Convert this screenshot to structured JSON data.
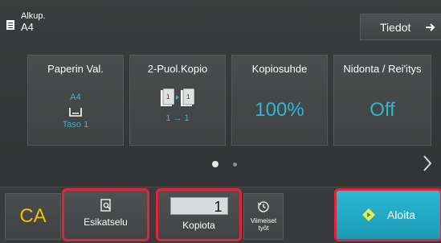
{
  "header": {
    "original_label": "Alkup.",
    "original_size": "A4",
    "info_label": "Tiedot"
  },
  "cards": [
    {
      "title": "Paperin Val.",
      "value": "A4",
      "sub": "Taso 1"
    },
    {
      "title": "2-Puol.Kopio",
      "sub": "1 → 1"
    },
    {
      "title": "Kopiosuhde",
      "value": "100%"
    },
    {
      "title": "Nidonta / Rei'itys",
      "value": "Off"
    }
  ],
  "bottom": {
    "ca_label": "CA",
    "preview_label": "Esikatselu",
    "copies_value": "1",
    "copies_label": "Kopiota",
    "recent_label_1": "Viimeiset",
    "recent_label_2": "työt",
    "start_label": "Aloita"
  },
  "colors": {
    "accent": "#2fb7d6",
    "highlight": "#e0253a",
    "ca": "#f0c000",
    "start": "#1fa9c4"
  },
  "icons": [
    "document-icon",
    "arrow-right-icon",
    "tray-icon",
    "duplex-icon",
    "chevron-right-icon",
    "preview-icon",
    "history-icon",
    "start-icon"
  ]
}
